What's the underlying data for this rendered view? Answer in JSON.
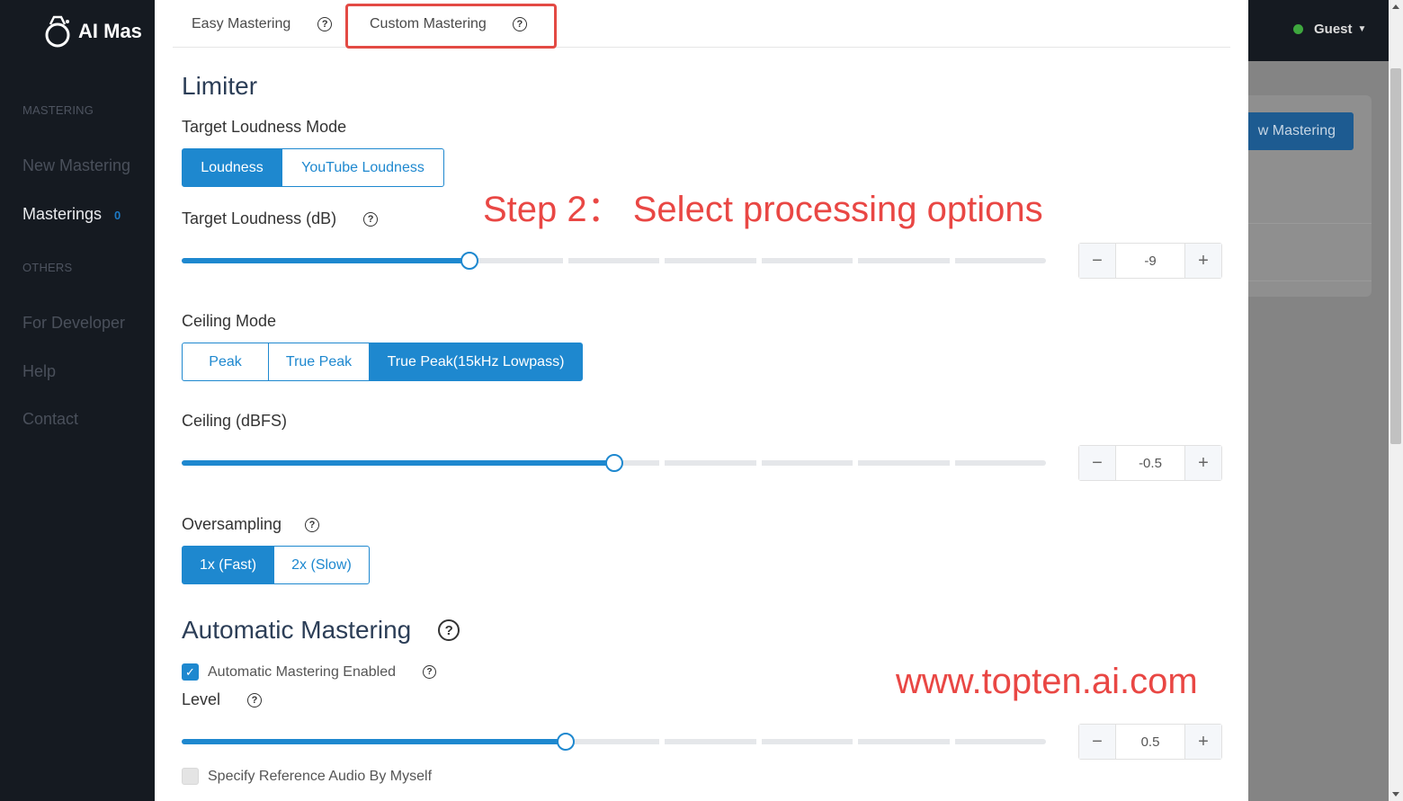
{
  "app": {
    "logo_text": "AI Mas",
    "user": "Guest"
  },
  "sidebar": {
    "sections": [
      {
        "title": "MASTERING",
        "items": [
          {
            "label": "New Mastering"
          },
          {
            "label": "Masterings",
            "badge": "0"
          }
        ]
      },
      {
        "title": "OTHERS",
        "items": [
          {
            "label": "For Developer"
          },
          {
            "label": "Help"
          },
          {
            "label": "Contact"
          }
        ]
      }
    ]
  },
  "background": {
    "new_mastering_button": "w Mastering"
  },
  "tabs": [
    {
      "label": "Easy Mastering",
      "help": "?"
    },
    {
      "label": "Custom Mastering",
      "help": "?",
      "highlighted": true
    }
  ],
  "limiter": {
    "title": "Limiter",
    "target_loudness_mode": {
      "label": "Target Loudness Mode",
      "options": [
        "Loudness",
        "YouTube Loudness"
      ],
      "selected": "Loudness"
    },
    "target_loudness": {
      "label": "Target Loudness (dB)",
      "help": "?",
      "value": "-9",
      "slider_fraction": 0.333
    },
    "ceiling_mode": {
      "label": "Ceiling Mode",
      "options": [
        "Peak",
        "True Peak",
        "True Peak(15kHz Lowpass)"
      ],
      "selected": "True Peak(15kHz Lowpass)"
    },
    "ceiling": {
      "label": "Ceiling (dBFS)",
      "value": "-0.5",
      "slider_fraction": 0.5
    },
    "oversampling": {
      "label": "Oversampling",
      "help": "?",
      "options": [
        "1x (Fast)",
        "2x (Slow)"
      ],
      "selected": "1x (Fast)"
    }
  },
  "automatic_mastering": {
    "title": "Automatic Mastering",
    "help": "?",
    "enabled_label": "Automatic Mastering Enabled",
    "enabled": true,
    "enabled_help": "?",
    "level": {
      "label": "Level",
      "help": "?",
      "value": "0.5",
      "slider_fraction": 0.444
    },
    "reference_label": "Specify Reference Audio By Myself",
    "reference_checked": false
  },
  "stepper": {
    "minus": "−",
    "plus": "+"
  },
  "annotations": {
    "step": "Step 2： Select processing options",
    "site": "www.topten.ai.com"
  },
  "colors": {
    "accent": "#1e88cf",
    "sidebar_bg": "#151a21",
    "annotation_red": "#e94744"
  }
}
